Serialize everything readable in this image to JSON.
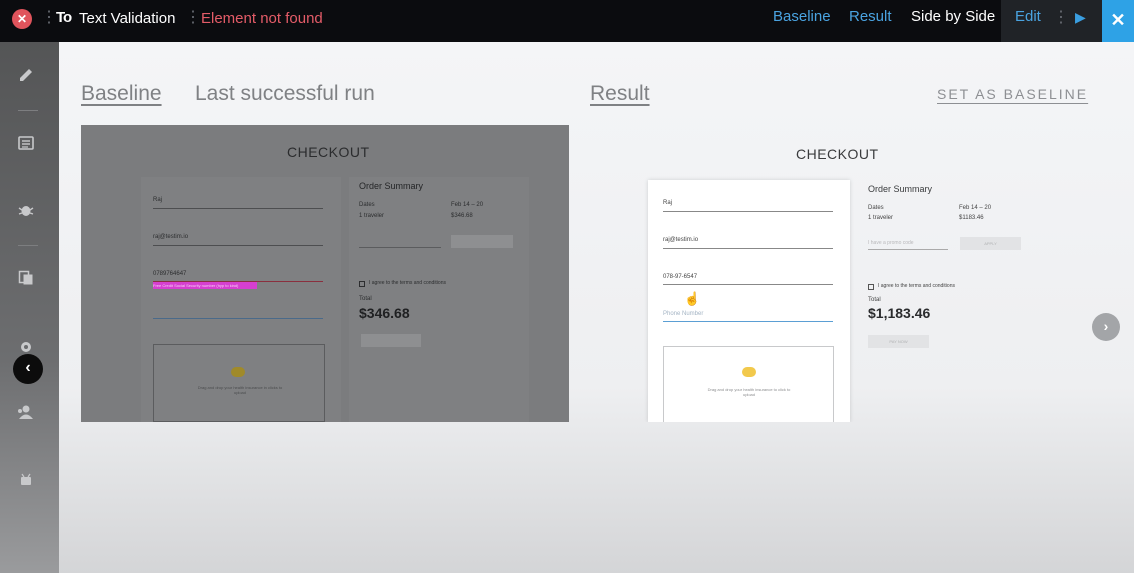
{
  "topbar": {
    "close_glyph": "✕",
    "logo": "To",
    "title": "Text Validation",
    "error": "Element not found",
    "nav": {
      "baseline": "Baseline",
      "result": "Result",
      "side_by_side": "Side by Side",
      "edit": "Edit"
    },
    "play_icon": "▶",
    "close_x": "✕"
  },
  "sidebar": {
    "icons": [
      "pencil-icon",
      "list-icon",
      "bug-icon",
      "copy-icon",
      "gear-icon",
      "users-icon",
      "android-icon"
    ],
    "collapse_glyph": "‹"
  },
  "main": {
    "baseline_heading": "Baseline",
    "last_run": "Last successful run",
    "result_heading": "Result",
    "set_as_baseline": "SET AS BASELINE",
    "next_glyph": "›"
  },
  "baseline_preview": {
    "checkout": "CHECKOUT",
    "name": "Raj",
    "email": "raj@testim.io",
    "ssn": "0789764647",
    "validation_msg": "Free Credit Social Security number (hyp to kind)",
    "order_summary": "Order Summary",
    "dates_label": "Dates",
    "dates_value": "Feb 14 – 20",
    "traveler": "1 traveler",
    "price": "$346.68",
    "terms": "I agree to the terms and conditions",
    "total_label": "Total",
    "total": "$346.68",
    "upload_hint": "Drag and drop your health insurance in clicks to upload"
  },
  "result_preview": {
    "checkout": "CHECKOUT",
    "name": "Raj",
    "email": "raj@testim.io",
    "ssn": "078-97-6547",
    "phone_placeholder": "Phone Number",
    "order_summary": "Order Summary",
    "dates_label": "Dates",
    "dates_value": "Feb 14 – 20",
    "traveler": "1 traveler",
    "price": "$1183.46",
    "promo_placeholder": "I have a promo code",
    "apply": "APPLY",
    "terms": "I agree to the terms and conditions",
    "total_label": "Total",
    "total": "$1,183.46",
    "pay_now": "PAY NOW",
    "upload_hint": "Drag and drop your health insurance to click to upload"
  },
  "colors": {
    "accent_blue": "#4aa3e0",
    "error_red": "#e45c68",
    "highlight_pink": "#d63fd0"
  }
}
